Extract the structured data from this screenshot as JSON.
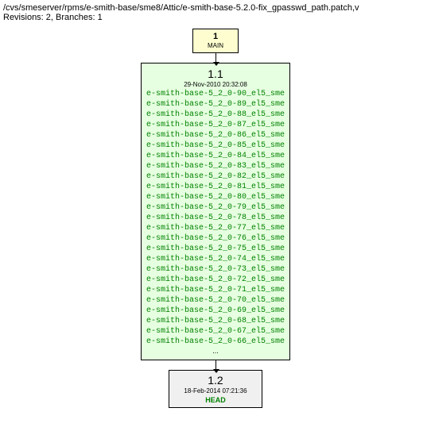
{
  "header": {
    "path": "/cvs/smeserver/rpms/e-smith-base/sme8/Attic/e-smith-base-5.2.0-fix_gpasswd_path.patch,v",
    "info": "Revisions: 2, Branches: 1"
  },
  "main_node": {
    "number": "1",
    "label": "MAIN"
  },
  "rev1": {
    "number": "1.1",
    "date": "29-Nov-2010 20:32:08",
    "tags": [
      "e-smith-base-5_2_0-90_el5_sme",
      "e-smith-base-5_2_0-89_el5_sme",
      "e-smith-base-5_2_0-88_el5_sme",
      "e-smith-base-5_2_0-87_el5_sme",
      "e-smith-base-5_2_0-86_el5_sme",
      "e-smith-base-5_2_0-85_el5_sme",
      "e-smith-base-5_2_0-84_el5_sme",
      "e-smith-base-5_2_0-83_el5_sme",
      "e-smith-base-5_2_0-82_el5_sme",
      "e-smith-base-5_2_0-81_el5_sme",
      "e-smith-base-5_2_0-80_el5_sme",
      "e-smith-base-5_2_0-79_el5_sme",
      "e-smith-base-5_2_0-78_el5_sme",
      "e-smith-base-5_2_0-77_el5_sme",
      "e-smith-base-5_2_0-76_el5_sme",
      "e-smith-base-5_2_0-75_el5_sme",
      "e-smith-base-5_2_0-74_el5_sme",
      "e-smith-base-5_2_0-73_el5_sme",
      "e-smith-base-5_2_0-72_el5_sme",
      "e-smith-base-5_2_0-71_el5_sme",
      "e-smith-base-5_2_0-70_el5_sme",
      "e-smith-base-5_2_0-69_el5_sme",
      "e-smith-base-5_2_0-68_el5_sme",
      "e-smith-base-5_2_0-67_el5_sme",
      "e-smith-base-5_2_0-66_el5_sme"
    ],
    "ellipsis": "..."
  },
  "rev2": {
    "number": "1.2",
    "date": "18-Feb-2014 07:21:36",
    "head": "HEAD"
  }
}
